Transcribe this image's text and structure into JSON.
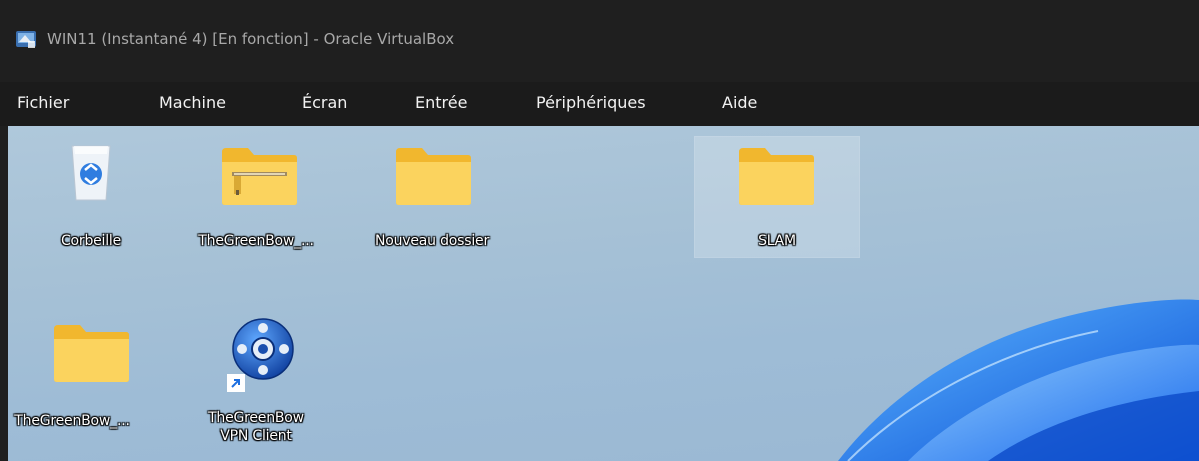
{
  "window": {
    "title": "WIN11 (Instantané 4) [En fonction] - Oracle VirtualBox"
  },
  "menu": {
    "fichier": "Fichier",
    "machine": "Machine",
    "ecran": "Écran",
    "entree": "Entrée",
    "peripheriques": "Périphériques",
    "aide": "Aide"
  },
  "desktop": {
    "icons": {
      "recycle_bin": "Corbeille",
      "zip_folder": "TheGreenBow_...",
      "new_folder": "Nouveau dossier",
      "slam": "SLAM",
      "folder_bottom": "TheGreenBow_...",
      "vpn_client_line1": "TheGreenBow",
      "vpn_client_line2": "VPN Client"
    }
  },
  "colors": {
    "titlebar": "#1f1f1f",
    "folder_yellow": "#f7c948",
    "vpn_blue": "#1f5fd0"
  }
}
